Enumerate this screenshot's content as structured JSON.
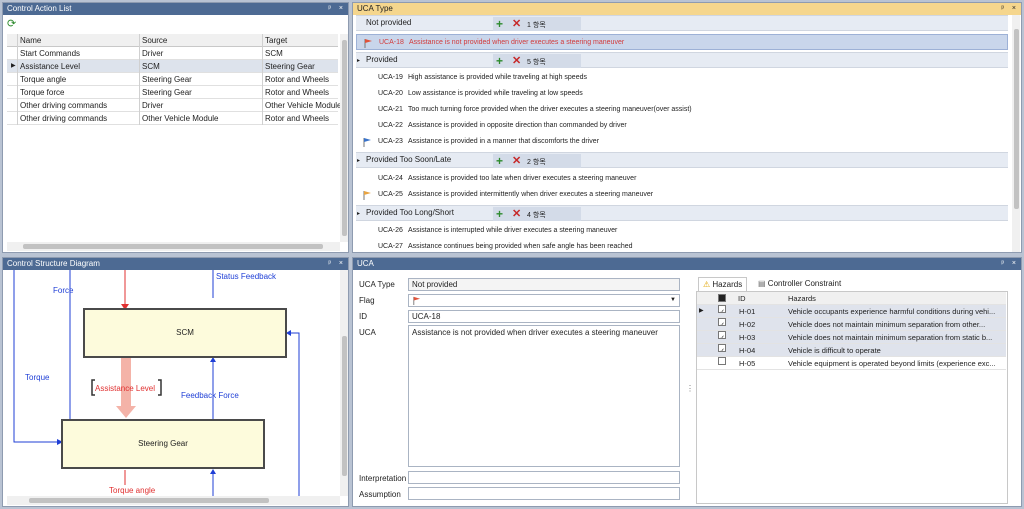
{
  "control_action_list": {
    "title": "Control Action List",
    "columns": [
      "Name",
      "Source",
      "Target"
    ],
    "rows": [
      {
        "name": "Start Commands",
        "source": "Driver",
        "target": "SCM"
      },
      {
        "name": "Assistance Level",
        "source": "SCM",
        "target": "Steering Gear"
      },
      {
        "name": "Torque angle",
        "source": "Steering Gear",
        "target": "Rotor and Wheels"
      },
      {
        "name": "Torque force",
        "source": "Steering Gear",
        "target": "Rotor and Wheels"
      },
      {
        "name": "Other driving commands",
        "source": "Driver",
        "target": "Other Vehicle Module"
      },
      {
        "name": "Other driving commands",
        "source": "Other Vehicle Module",
        "target": "Rotor and Wheels"
      }
    ]
  },
  "uca_type_panel": {
    "title": "UCA Type",
    "groups": [
      {
        "name": "Not provided",
        "count": "1 항목",
        "items": [
          {
            "id": "UCA-18",
            "text": "Assistance is not provided when driver executes a steering maneuver",
            "flag": "red",
            "selected": true
          }
        ]
      },
      {
        "name": "Provided",
        "count": "5 항목",
        "items": [
          {
            "id": "UCA-19",
            "text": "High assistance is provided while traveling at high speeds",
            "flag": "",
            "selected": false
          },
          {
            "id": "UCA-20",
            "text": "Low assistance is provided while traveling at low speeds",
            "flag": "",
            "selected": false
          },
          {
            "id": "UCA-21",
            "text": "Too much turning force provided when the driver executes a steering maneuver(over assist)",
            "flag": "",
            "selected": false
          },
          {
            "id": "UCA-22",
            "text": "Assistance is provided in opposite direction than commanded by driver",
            "flag": "",
            "selected": false
          },
          {
            "id": "UCA-23",
            "text": "Assistance is provided in a manner that discomforts the driver",
            "flag": "blue",
            "selected": false
          }
        ]
      },
      {
        "name": "Provided Too Soon/Late",
        "count": "2 항목",
        "items": [
          {
            "id": "UCA-24",
            "text": "Assistance is provided too late when driver executes a steering maneuver",
            "flag": "",
            "selected": false
          },
          {
            "id": "UCA-25",
            "text": "Assistance is provided intermittently when driver executes a steering maneuver",
            "flag": "orange",
            "selected": false
          }
        ]
      },
      {
        "name": "Provided Too Long/Short",
        "count": "4 항목",
        "items": [
          {
            "id": "UCA-26",
            "text": "Assistance is interrupted while driver executes a steering maneuver",
            "flag": "",
            "selected": false
          },
          {
            "id": "UCA-27",
            "text": "Assistance continues being provided when safe angle has been reached",
            "flag": "",
            "selected": false
          }
        ]
      }
    ]
  },
  "diagram": {
    "title": "Control Structure Diagram",
    "scm": "SCM",
    "steering_gear": "Steering Gear",
    "status_feedback": "Status Feedback",
    "force": "Force",
    "torque": "Torque",
    "assistance_level": "Assistance Level",
    "feedback_force": "Feedback Force",
    "torque_angle": "Torque angle"
  },
  "uca_form": {
    "title": "UCA",
    "uca_type_label": "UCA Type",
    "uca_type_value": "Not provided",
    "flag_label": "Flag",
    "id_label": "ID",
    "id_value": "UCA-18",
    "uca_label": "UCA",
    "uca_value": "Assistance is not provided when driver executes a steering maneuver",
    "interpretation_label": "Interpretation",
    "assumption_label": "Assumption"
  },
  "hazards": {
    "tab_hazards": "Hazards",
    "tab_controller_constraint": "Controller Constraint",
    "col_id": "ID",
    "col_hazards": "Hazards",
    "rows": [
      {
        "id": "H-01",
        "text": "Vehicle occupants experience harmful conditions during vehi...",
        "checked": true
      },
      {
        "id": "H-02",
        "text": "Vehicle does not maintain minimum separation from other...",
        "checked": true
      },
      {
        "id": "H-03",
        "text": "Vehicle does not maintain minimum separation from static b...",
        "checked": true
      },
      {
        "id": "H-04",
        "text": "Vehicle is difficult to operate",
        "checked": true
      },
      {
        "id": "H-05",
        "text": "Vehicle equipment is operated beyond limits (experience exc...",
        "checked": false
      }
    ]
  },
  "colors": {
    "title_bar": "#4d6a93",
    "active_title": "#f5d68d",
    "selected_text": "#d23b3b",
    "diagram_red": "#e03030",
    "diagram_blue": "#1f3fd6"
  }
}
